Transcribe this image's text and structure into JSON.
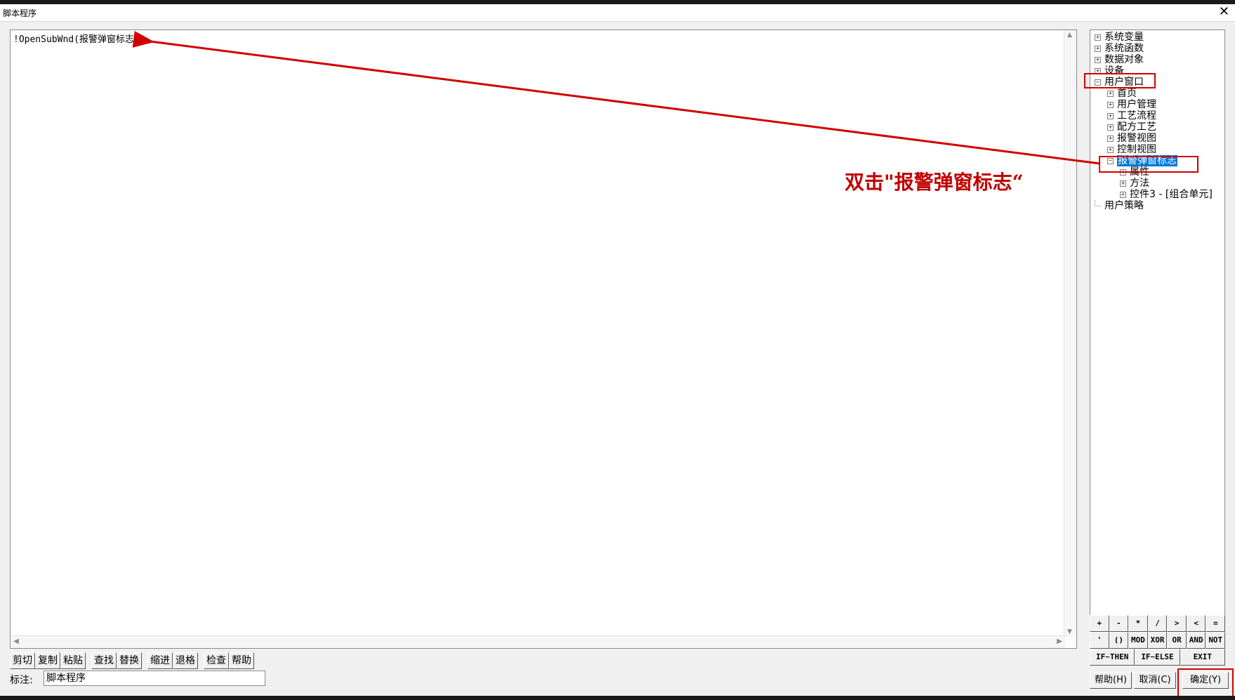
{
  "window": {
    "title": "脚本程序",
    "close_glyph": "✕"
  },
  "editor": {
    "code_line": "!OpenSubWnd(报警弹窗标志 )"
  },
  "toolbar": {
    "cut": "剪切",
    "copy": "复制",
    "paste": "粘贴",
    "find": "查找",
    "replace": "替换",
    "indent": "缩进",
    "outdent": "退格",
    "check": "检查",
    "help": "帮助"
  },
  "note": {
    "label": "标注:",
    "value": "脚本程序"
  },
  "tree": {
    "system_vars": "系统变量",
    "system_funcs": "系统函数",
    "data_objects": "数据对象",
    "devices": "设备",
    "user_windows": "用户窗口",
    "windows": [
      "首页",
      "用户管理",
      "工艺流程",
      "配方工艺",
      "报警视图",
      "控制视图"
    ],
    "selected_window": "报警弹窗标志",
    "window_children": [
      "属性",
      "方法",
      "控件3 - [组合单元]"
    ],
    "user_strategy": "用户策略"
  },
  "keypad": {
    "row1": [
      "+",
      "-",
      "*",
      "/",
      ">",
      "<",
      "="
    ],
    "row2": [
      "'",
      "()",
      "MOD",
      "XOR",
      "OR",
      "AND",
      "NOT"
    ],
    "row3": [
      "IF~THEN",
      "IF~ELSE",
      "EXIT"
    ]
  },
  "dialog_buttons": {
    "help": "帮助(H)",
    "cancel": "取消(C)",
    "ok": "确定(Y)"
  },
  "annotation": {
    "text": "双击\"报警弹窗标志“",
    "color": "#c00000"
  },
  "colors": {
    "selection": "#0078d7",
    "highlight_box": "#d10000"
  }
}
